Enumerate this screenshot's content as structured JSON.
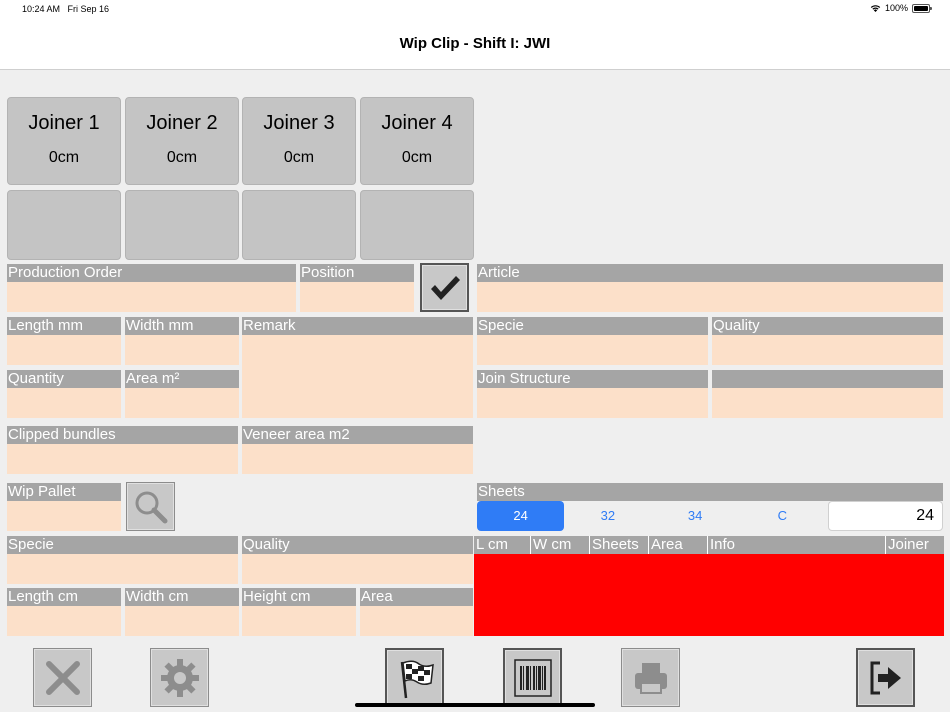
{
  "status": {
    "time": "10:24 AM",
    "date": "Fri Sep 16",
    "battery": "100%"
  },
  "nav": {
    "title": "Wip Clip - Shift I: JWI"
  },
  "joiners": [
    {
      "name": "Joiner 1",
      "value": "0cm"
    },
    {
      "name": "Joiner 2",
      "value": "0cm"
    },
    {
      "name": "Joiner 3",
      "value": "0cm"
    },
    {
      "name": "Joiner 4",
      "value": "0cm"
    }
  ],
  "labels": {
    "production_order": "Production Order",
    "position": "Position",
    "article": "Article",
    "length_mm": "Length mm",
    "width_mm": "Width mm",
    "remark": "Remark",
    "specie": "Specie",
    "quality": "Quality",
    "quantity": "Quantity",
    "area_m2": "Area m²",
    "join_structure": "Join Structure",
    "clipped_bundles": "Clipped bundles",
    "veneer_area": "Veneer area m2",
    "wip_pallet": "Wip Pallet",
    "sheets": "Sheets",
    "specie2": "Specie",
    "quality2": "Quality",
    "length_cm": "Length cm",
    "width_cm": "Width cm",
    "height_cm": "Height cm",
    "area": "Area"
  },
  "sheets": {
    "options": [
      "24",
      "32",
      "34",
      "C"
    ],
    "selected": "24",
    "value": "24"
  },
  "table": {
    "columns": [
      "L cm",
      "W cm",
      "Sheets",
      "Area",
      "Info",
      "Joiner"
    ]
  },
  "icons": {
    "confirm": "checkmark-icon",
    "search": "magnifier-icon",
    "cancel": "x-icon",
    "settings": "gear-icon",
    "finish": "checkered-flag-icon",
    "barcode": "barcode-icon",
    "print": "printer-icon",
    "exit": "exit-icon"
  },
  "colors": {
    "label_bg": "#a5a5a5",
    "field_bg": "#fce0c9",
    "table_bg": "#ff0000",
    "accent": "#2f7cf6"
  }
}
